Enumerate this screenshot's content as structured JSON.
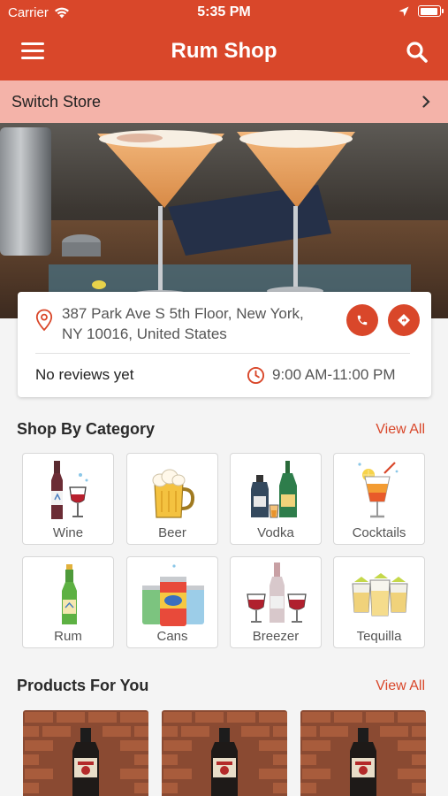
{
  "status_bar": {
    "carrier": "Carrier",
    "time": "5:35 PM",
    "battery_level": 0.95
  },
  "header": {
    "title": "Rum Shop"
  },
  "switch_store": {
    "label": "Switch Store"
  },
  "store": {
    "address_line1": "387 Park Ave S 5th Floor, New York,",
    "address_line2": "NY 10016, United States",
    "reviews": "No reviews yet",
    "hours": "9:00 AM-11:00 PM"
  },
  "categories_section": {
    "title": "Shop By Category",
    "view_all": "View All"
  },
  "categories": [
    {
      "name": "Wine",
      "icon": "wine-icon"
    },
    {
      "name": "Beer",
      "icon": "beer-icon"
    },
    {
      "name": "Vodka",
      "icon": "vodka-icon"
    },
    {
      "name": "Cocktails",
      "icon": "cocktails-icon"
    },
    {
      "name": "Rum",
      "icon": "rum-icon"
    },
    {
      "name": "Cans",
      "icon": "cans-icon"
    },
    {
      "name": "Breezer",
      "icon": "breezer-icon"
    },
    {
      "name": "Tequilla",
      "icon": "tequilla-icon"
    }
  ],
  "products_section": {
    "title": "Products For You",
    "view_all": "View All"
  },
  "colors": {
    "accent": "#d9472a",
    "switch_bar": "#f4b3a9",
    "background": "#f4f4f4"
  }
}
